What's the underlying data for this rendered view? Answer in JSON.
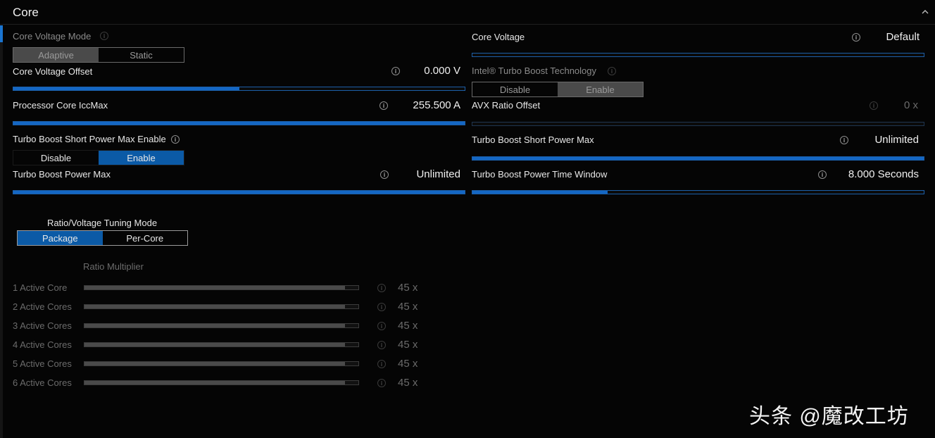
{
  "header": {
    "title": "Core"
  },
  "left": {
    "voltage_mode": {
      "label": "Core Voltage Mode",
      "options": [
        "Adaptive",
        "Static"
      ],
      "selected": "Adaptive"
    },
    "voltage_offset": {
      "label": "Core Voltage Offset",
      "value": "0.000 V",
      "fill": 0.5
    },
    "iccmax": {
      "label": "Processor Core IccMax",
      "value": "255.500 A",
      "fill": 1.0
    },
    "short_power_enable": {
      "label": "Turbo Boost Short Power Max Enable",
      "options": [
        "Disable",
        "Enable"
      ],
      "selected": "Enable"
    },
    "power_max": {
      "label": "Turbo Boost Power Max",
      "value": "Unlimited",
      "fill": 1.0
    }
  },
  "right": {
    "core_voltage": {
      "label": "Core Voltage",
      "value": "Default",
      "fill": 0.0
    },
    "turbo_boost_tech": {
      "label": "Intel® Turbo Boost Technology",
      "options": [
        "Disable",
        "Enable"
      ],
      "selected": "Enable"
    },
    "avx_offset": {
      "label": "AVX Ratio Offset",
      "value": "0 x",
      "fill": 0.0
    },
    "short_power_max": {
      "label": "Turbo Boost Short Power Max",
      "value": "Unlimited",
      "fill": 1.0
    },
    "time_window": {
      "label": "Turbo Boost Power Time Window",
      "value": "8.000 Seconds",
      "fill": 0.3
    }
  },
  "tuning": {
    "title": "Ratio/Voltage Tuning Mode",
    "options": [
      "Package",
      "Per-Core"
    ],
    "selected": "Package",
    "ratio_header": "Ratio Multiplier",
    "cores": [
      {
        "label": "1 Active Core",
        "value": "45 x",
        "fill": 0.95
      },
      {
        "label": "2 Active Cores",
        "value": "45 x",
        "fill": 0.95
      },
      {
        "label": "3 Active Cores",
        "value": "45 x",
        "fill": 0.95
      },
      {
        "label": "4 Active Cores",
        "value": "45 x",
        "fill": 0.95
      },
      {
        "label": "5 Active Cores",
        "value": "45 x",
        "fill": 0.95
      },
      {
        "label": "6 Active Cores",
        "value": "45 x",
        "fill": 0.95
      }
    ]
  },
  "watermark": "头条 @魔改工坊",
  "colors": {
    "accent": "#1467c4",
    "background": "#050505",
    "selected_segment": "#0b5aa6"
  }
}
